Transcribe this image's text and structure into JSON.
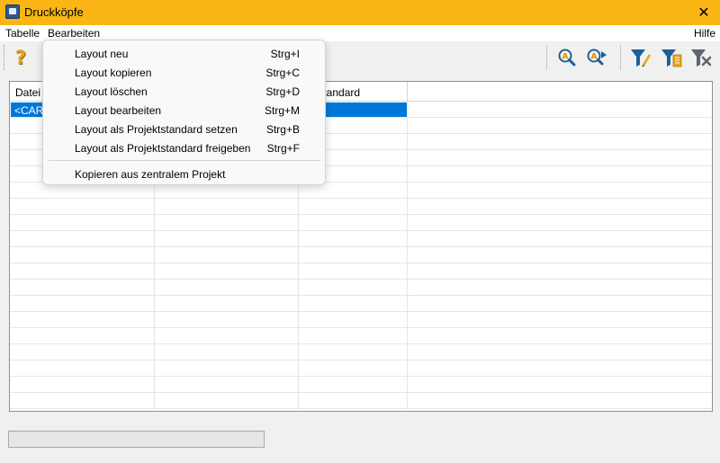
{
  "window": {
    "title": "Druckköpfe",
    "close_glyph": "✕"
  },
  "menubar": {
    "items": [
      "Tabelle",
      "Bearbeiten"
    ],
    "help": "Hilfe"
  },
  "toolbar": {
    "help_glyph": "?",
    "icons": [
      "help-icon",
      "zoom-search-icon",
      "zoom-forward-icon",
      "filter-edit-icon",
      "filter-list-icon",
      "filter-clear-icon"
    ]
  },
  "table": {
    "columns": [
      "Datei",
      "",
      "ktstandard",
      ""
    ],
    "selected_cell": "<CARI"
  },
  "context_menu": {
    "items": [
      {
        "label": "Layout neu",
        "shortcut": "Strg+I"
      },
      {
        "label": "Layout kopieren",
        "shortcut": "Strg+C"
      },
      {
        "label": "Layout löschen",
        "shortcut": "Strg+D"
      },
      {
        "label": "Layout bearbeiten",
        "shortcut": "Strg+M"
      },
      {
        "label": "Layout als Projektstandard setzen",
        "shortcut": "Strg+B"
      },
      {
        "label": "Layout als Projektstandard freigeben",
        "shortcut": "Strg+F"
      }
    ],
    "extra_item": {
      "label": "Kopieren aus zentralem Projekt"
    }
  },
  "colors": {
    "titlebar": "#fbb615",
    "selection": "#0078d7",
    "filter_blue": "#1d5f9f"
  }
}
